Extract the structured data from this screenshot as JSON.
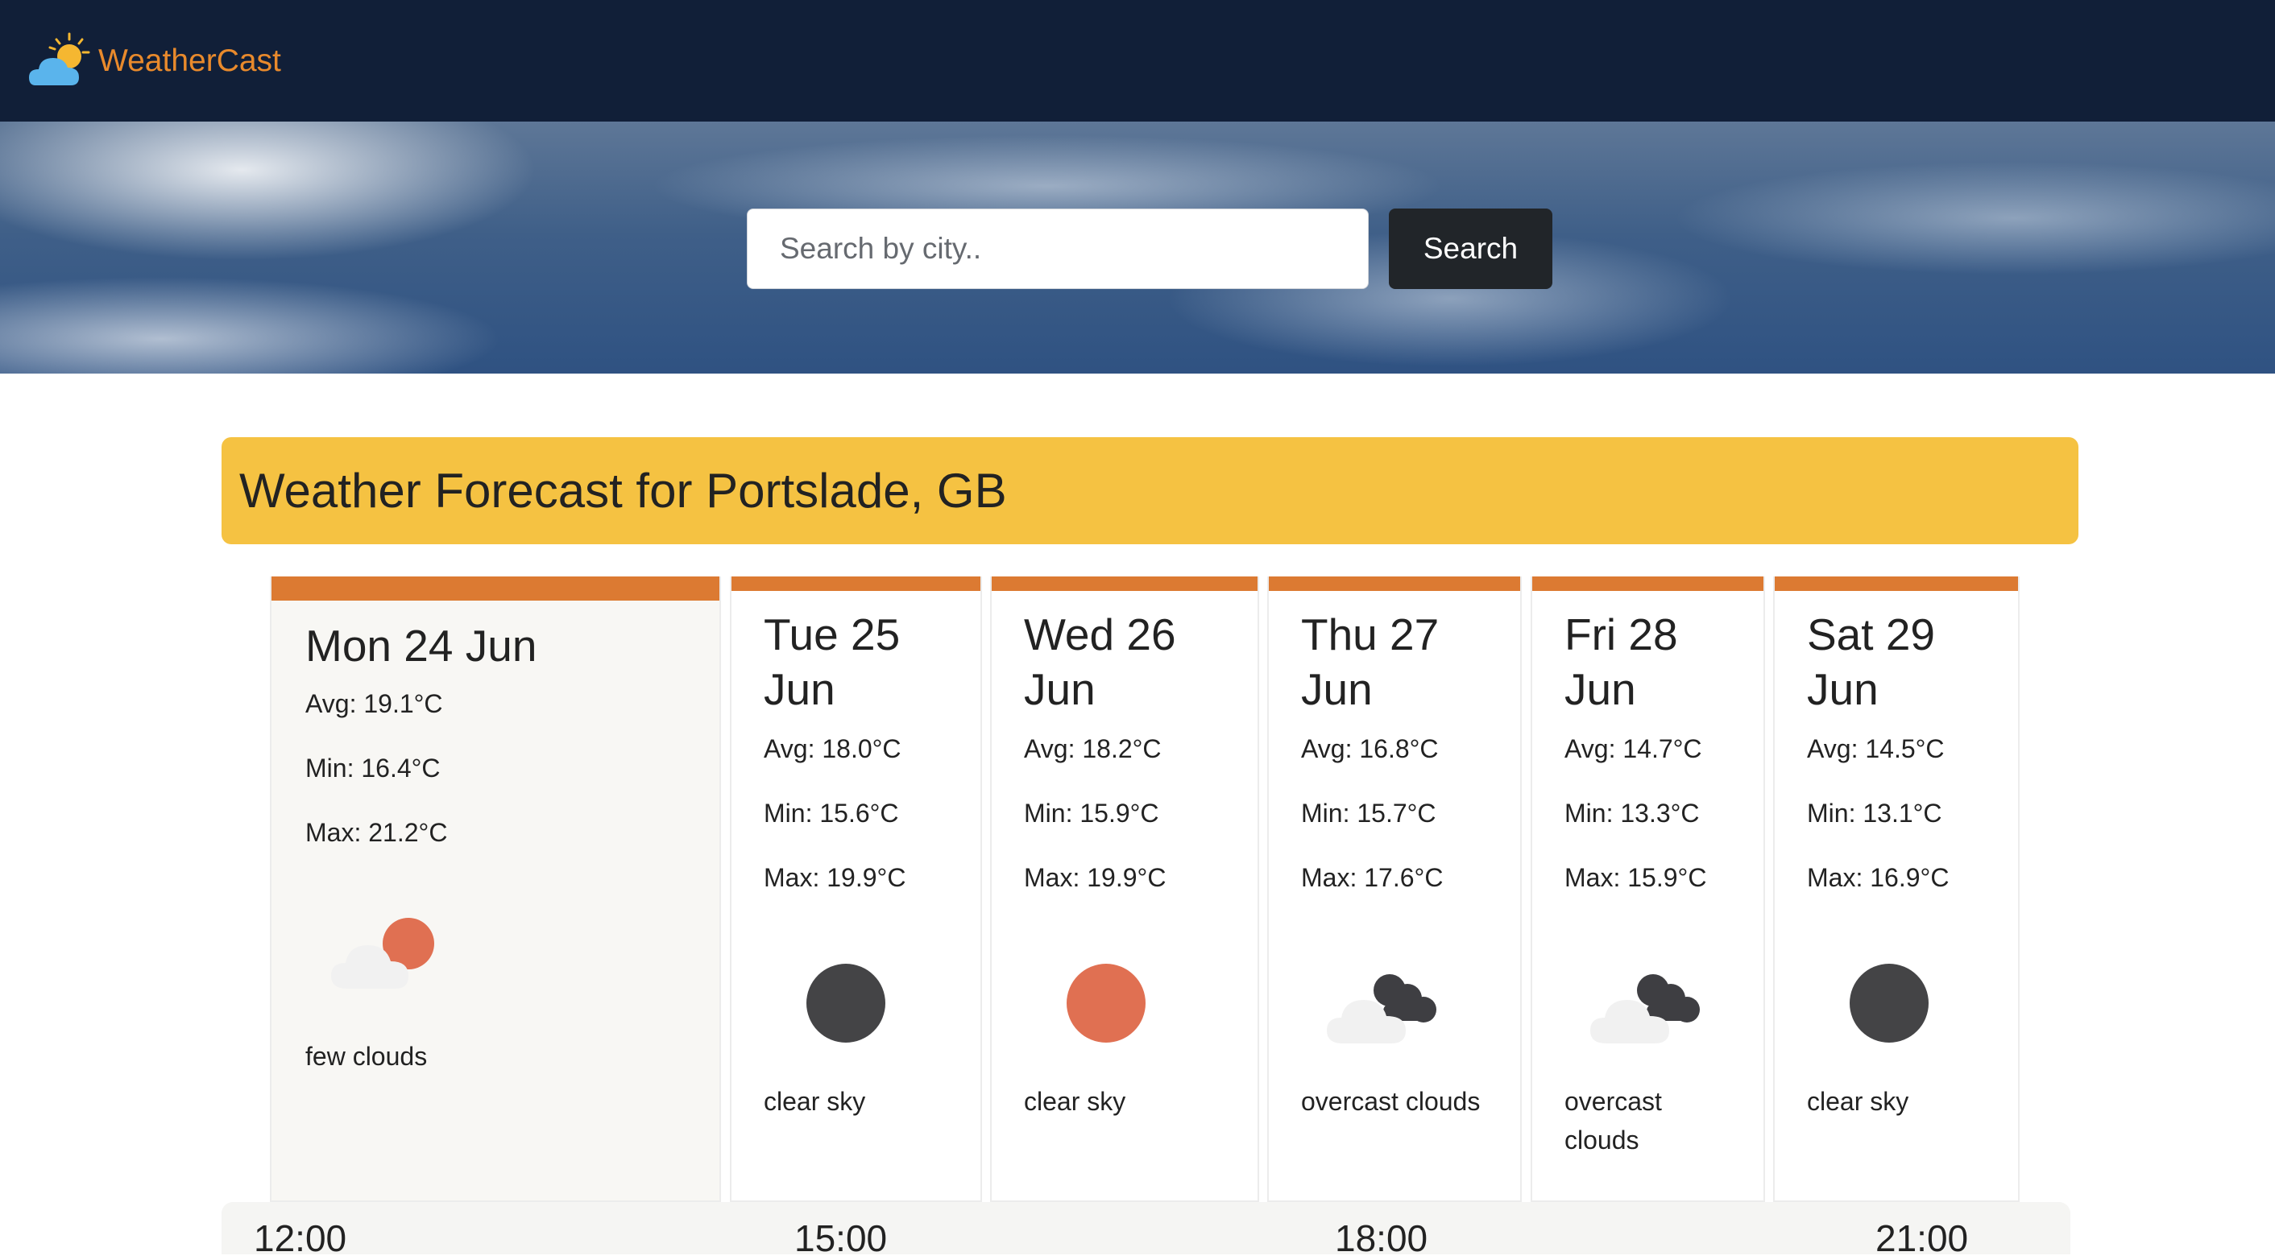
{
  "app": {
    "brand": "WeatherCast"
  },
  "search": {
    "placeholder": "Search by city..",
    "button_label": "Search"
  },
  "forecast": {
    "title": "Weather Forecast for Portslade, GB",
    "days": [
      {
        "date": "Mon 24 Jun",
        "avg": "Avg: 19.1°C",
        "min": "Min: 16.4°C",
        "max": "Max: 21.2°C",
        "icon": "few-clouds-icon",
        "desc": "few clouds"
      },
      {
        "date": "Tue 25 Jun",
        "avg": "Avg: 18.0°C",
        "min": "Min: 15.6°C",
        "max": "Max: 19.9°C",
        "icon": "clear-sky-icon",
        "desc": "clear sky"
      },
      {
        "date": "Wed 26 Jun",
        "avg": "Avg: 18.2°C",
        "min": "Min: 15.9°C",
        "max": "Max: 19.9°C",
        "icon": "sun-icon",
        "desc": "clear sky"
      },
      {
        "date": "Thu 27 Jun",
        "avg": "Avg: 16.8°C",
        "min": "Min: 15.7°C",
        "max": "Max: 17.6°C",
        "icon": "overcast-clouds-icon",
        "desc": "overcast clouds"
      },
      {
        "date": "Fri 28 Jun",
        "avg": "Avg: 14.7°C",
        "min": "Min: 13.3°C",
        "max": "Max: 15.9°C",
        "icon": "overcast-clouds-icon",
        "desc": "overcast clouds"
      },
      {
        "date": "Sat 29 Jun",
        "avg": "Avg: 14.5°C",
        "min": "Min: 13.1°C",
        "max": "Max: 16.9°C",
        "icon": "clear-sky-icon",
        "desc": "clear sky"
      }
    ]
  },
  "hourly": {
    "times": [
      "12:00",
      "15:00",
      "18:00",
      "21:00"
    ]
  },
  "colors": {
    "navbar": "#111f38",
    "accent": "#dc7a32",
    "header": "#f5c242",
    "brand_text": "#e98a2c",
    "button": "#212529"
  }
}
